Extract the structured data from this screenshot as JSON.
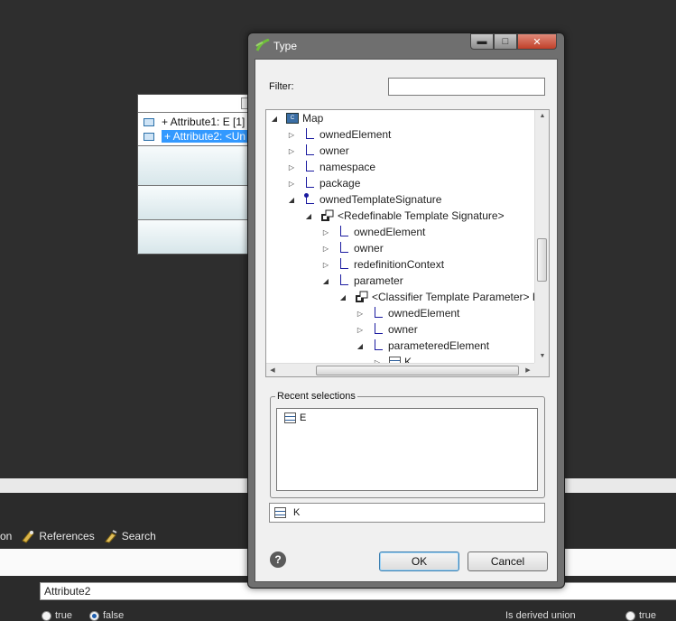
{
  "background": {
    "class_box": {
      "attributes": [
        {
          "text": "+ Attribute1: E [1]",
          "selected": false
        },
        {
          "text": "+ Attribute2: <Un",
          "selected": true
        }
      ]
    },
    "toolbar": {
      "items": [
        {
          "label": "on",
          "icon": "partial-icon"
        },
        {
          "label": "References",
          "icon": "references-icon"
        },
        {
          "label": "Search",
          "icon": "search-icon"
        }
      ]
    },
    "name_field_value": "Attribute2",
    "radio_true_label": "true",
    "radio_false_label": "false",
    "radio_selected": "false",
    "derived_union_label": "Is derived union",
    "derived_union_true_label": "true"
  },
  "dialog": {
    "title": "Type",
    "window_buttons": {
      "minimize": "minimize",
      "maximize": "maximize",
      "close": "close"
    },
    "filter_label": "Filter:",
    "filter_value": "",
    "tree": [
      {
        "label": "Map",
        "icon": "map-icon",
        "twisty": "expanded",
        "depth": 0
      },
      {
        "label": "ownedElement",
        "icon": "ref-icon",
        "twisty": "collapsed",
        "depth": 1
      },
      {
        "label": "owner",
        "icon": "ref-icon",
        "twisty": "collapsed",
        "depth": 1
      },
      {
        "label": "namespace",
        "icon": "ref-icon",
        "twisty": "collapsed",
        "depth": 1
      },
      {
        "label": "package",
        "icon": "ref-icon",
        "twisty": "collapsed",
        "depth": 1
      },
      {
        "label": "ownedTemplateSignature",
        "icon": "ref-dot-icon",
        "twisty": "expanded",
        "depth": 1
      },
      {
        "label": "<Redefinable Template Signature>",
        "icon": "puzzle-icon",
        "twisty": "expanded",
        "depth": 2
      },
      {
        "label": "ownedElement",
        "icon": "ref-icon",
        "twisty": "collapsed",
        "depth": 3
      },
      {
        "label": "owner",
        "icon": "ref-icon",
        "twisty": "collapsed",
        "depth": 3
      },
      {
        "label": "redefinitionContext",
        "icon": "ref-icon",
        "twisty": "collapsed",
        "depth": 3
      },
      {
        "label": "parameter",
        "icon": "ref-icon",
        "twisty": "expanded",
        "depth": 3
      },
      {
        "label": "<Classifier Template Parameter> K",
        "icon": "puzzle-icon",
        "twisty": "expanded",
        "depth": 4
      },
      {
        "label": "ownedElement",
        "icon": "ref-icon",
        "twisty": "collapsed",
        "depth": 5
      },
      {
        "label": "owner",
        "icon": "ref-icon",
        "twisty": "collapsed",
        "depth": 5
      },
      {
        "label": "parameteredElement",
        "icon": "ref-icon",
        "twisty": "expanded",
        "depth": 5
      },
      {
        "label": "K",
        "icon": "class-icon",
        "twisty": "collapsed",
        "depth": 6
      }
    ],
    "recent_selections_label": "Recent selections",
    "recent_items": [
      {
        "label": "E",
        "icon": "class-icon"
      }
    ],
    "selected_value": {
      "label": "K",
      "icon": "class-icon"
    },
    "help_icon": "?",
    "ok_label": "OK",
    "cancel_label": "Cancel"
  }
}
